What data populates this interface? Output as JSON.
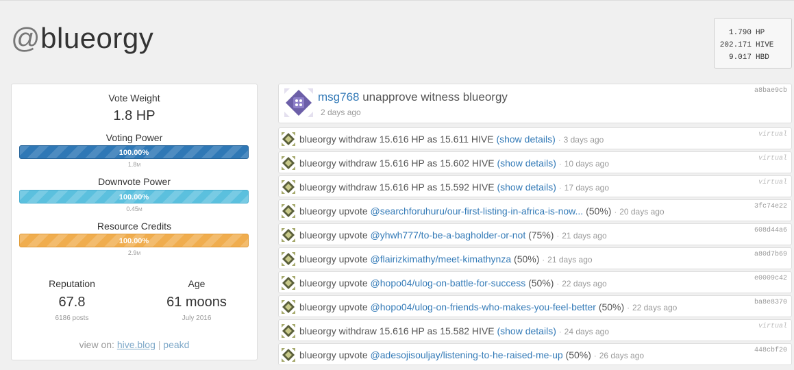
{
  "profile": {
    "at": "@",
    "name": "blueorgy"
  },
  "balances": [
    {
      "amount": "1.790",
      "unit": "HP"
    },
    {
      "amount": "202.171",
      "unit": "HIVE"
    },
    {
      "amount": "9.017",
      "unit": "HBD"
    }
  ],
  "stats": {
    "vote_weight_label": "Vote Weight",
    "vote_weight_value": "1.8 HP",
    "voting_power": {
      "label": "Voting Power",
      "percent_text": "100.00%",
      "fill": 1.0,
      "sub": "1.8",
      "suffix": "M"
    },
    "downvote_power": {
      "label": "Downvote Power",
      "percent_text": "100.00%",
      "fill": 1.0,
      "sub": "0.45",
      "suffix": "M"
    },
    "resource_credits": {
      "label": "Resource Credits",
      "percent_text": "100.00%",
      "fill": 1.0,
      "sub": "2.9",
      "suffix": "M"
    },
    "reputation": {
      "label": "Reputation",
      "value": "67.8",
      "sub": "6186 posts"
    },
    "age": {
      "label": "Age",
      "value": "61 moons",
      "sub": "July 2016"
    },
    "view_on": {
      "label": "view on:",
      "link1": "hive.blog",
      "separator": "|",
      "link2": "peakd"
    }
  },
  "colors": {
    "voting_bar": "#2f78b6",
    "downvote_bar": "#5bc0de",
    "rc_bar": "#f0ad4e",
    "link": "#337ab7"
  },
  "feed": {
    "top": {
      "actor": "msg768",
      "action": "unapprove witness blueorgy",
      "time": "2 days ago",
      "hash": "a8bae9cb",
      "icon": "avatar-purple-icon"
    },
    "items": [
      {
        "pre": "blueorgy withdraw 15.616 HP as 15.611 HIVE",
        "link": "(show details)",
        "post": "",
        "time": "3 days ago",
        "hash": "virtual",
        "virtual": true
      },
      {
        "pre": "blueorgy withdraw 15.616 HP as 15.602 HIVE",
        "link": "(show details)",
        "post": "",
        "time": "10 days ago",
        "hash": "virtual",
        "virtual": true
      },
      {
        "pre": "blueorgy withdraw 15.616 HP as 15.592 HIVE",
        "link": "(show details)",
        "post": "",
        "time": "17 days ago",
        "hash": "virtual",
        "virtual": true
      },
      {
        "pre": "blueorgy upvote",
        "link": "@searchforuhuru/our-first-listing-in-africa-is-now...",
        "post": "(50%)",
        "time": "20 days ago",
        "hash": "3fc74e22",
        "virtual": false
      },
      {
        "pre": "blueorgy upvote",
        "link": "@yhwh777/to-be-a-bagholder-or-not",
        "post": "(75%)",
        "time": "21 days ago",
        "hash": "608d44a6",
        "virtual": false
      },
      {
        "pre": "blueorgy upvote",
        "link": "@flairizkimathy/meet-kimathynza",
        "post": "(50%)",
        "time": "21 days ago",
        "hash": "a80d7b69",
        "virtual": false
      },
      {
        "pre": "blueorgy upvote",
        "link": "@hopo04/ulog-on-battle-for-success",
        "post": "(50%)",
        "time": "22 days ago",
        "hash": "e0009c42",
        "virtual": false
      },
      {
        "pre": "blueorgy upvote",
        "link": "@hopo04/ulog-on-friends-who-makes-you-feel-better",
        "post": "(50%)",
        "time": "22 days ago",
        "hash": "ba8e8370",
        "virtual": false
      },
      {
        "pre": "blueorgy withdraw 15.616 HP as 15.582 HIVE",
        "link": "(show details)",
        "post": "",
        "time": "24 days ago",
        "hash": "virtual",
        "virtual": true
      },
      {
        "pre": "blueorgy upvote",
        "link": "@adesojisouljay/listening-to-he-raised-me-up",
        "post": "(50%)",
        "time": "26 days ago",
        "hash": "448cbf20",
        "virtual": false
      }
    ]
  }
}
